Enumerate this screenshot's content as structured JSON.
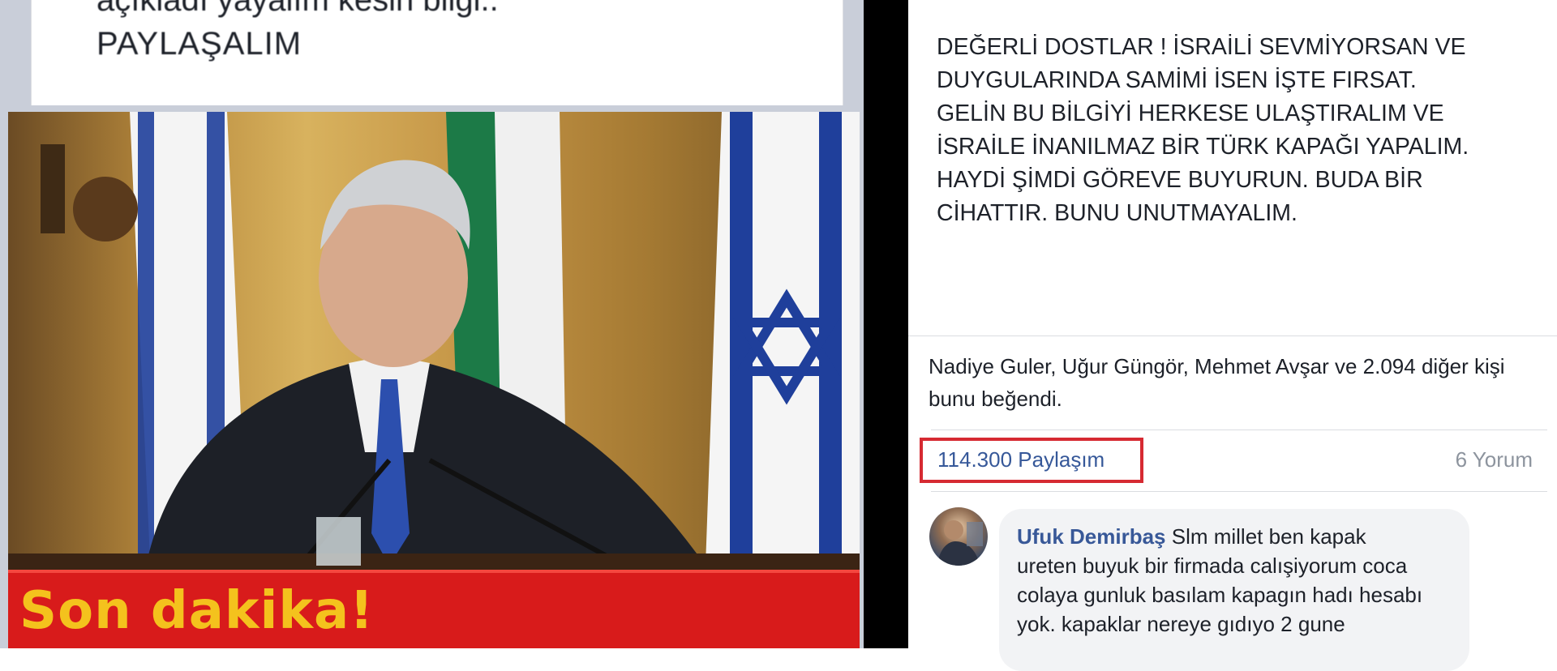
{
  "left_post": {
    "text_line_1": "açıkladı yayalım kesin bilgi..",
    "text_line_2": "PAYLAŞALIM",
    "banner_text": "Son dakika!"
  },
  "right_post": {
    "body_lines": [
      "DEĞERLİ DOSTLAR ! İSRAİLİ SEVMİYORSAN VE",
      "DUYGULARINDA SAMİMİ İSEN İŞTE FIRSAT.",
      "GELİN BU BİLGİYİ HERKESE ULAŞTIRALIM VE",
      "İSRAİLE İNANILMAZ BİR TÜRK KAPAĞI YAPALIM.",
      "HAYDİ ŞİMDİ GÖREVE BUYURUN. BUDA BİR",
      "CİHATTIR. BUNU UNUTMAYALIM."
    ],
    "likes_text": "Nadiye Guler, Uğur Güngör, Mehmet Avşar ve 2.094 diğer kişi bunu beğendi.",
    "share_count": "114.300 Paylaşım",
    "comment_count": "6 Yorum"
  },
  "comment": {
    "author": "Ufuk Demirbaş",
    "first_line": " Slm millet ben kapak",
    "lines": [
      "ureten buyuk bir firmada calışiyorum coca",
      "colaya gunluk basılam kapagın hadı hesabı",
      "yok. kapaklar nereye gıdıyo 2 gune"
    ]
  },
  "colors": {
    "link_blue": "#365899",
    "highlight_red": "#d62a32",
    "banner_red": "#d81b1b",
    "banner_yellow": "#f4c21d"
  }
}
